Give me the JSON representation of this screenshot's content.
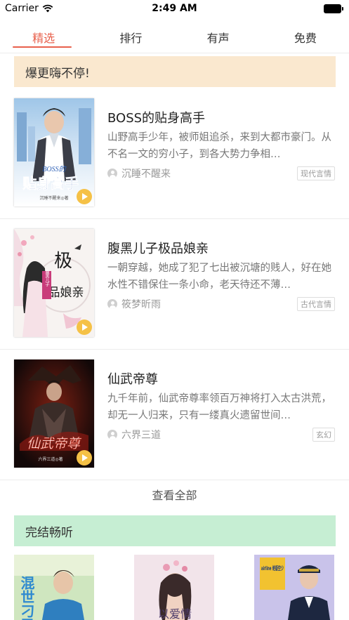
{
  "status_bar": {
    "carrier": "Carrier",
    "time": "2:49 AM"
  },
  "tabs": [
    {
      "label": "精选",
      "active": true
    },
    {
      "label": "排行",
      "active": false
    },
    {
      "label": "有声",
      "active": false
    },
    {
      "label": "免费",
      "active": false
    }
  ],
  "promo_banner": {
    "text": "爆更嗨不停!"
  },
  "books": [
    {
      "title": "BOSS的贴身高手",
      "description": "山野高手少年，被师姐追杀，来到大都市豪门。从不名一文的穷小子，到各大势力争相…",
      "author": "沉睡不醒来",
      "genre": "现代言情",
      "cover_text": {
        "line1": "BOSS的",
        "line2": "贴身高手",
        "byline": "沉睡不醒来◎著"
      }
    },
    {
      "title": "腹黑儿子极品娘亲",
      "description": "一朝穿越，她成了犯了七出被沉塘的贱人，好在她水性不错保住一条小命，老天待还不薄…",
      "author": "筱梦昕雨",
      "genre": "古代言情",
      "cover_text": {
        "line1": "极",
        "line2": "品娘亲",
        "side": "腹黑儿子"
      }
    },
    {
      "title": "仙武帝尊",
      "description": "九千年前，仙武帝尊率领百万神将打入太古洪荒，却无一人归来，只有一缕真火遗留世间…",
      "author": "六界三道",
      "genre": "玄幻",
      "cover_text": {
        "line1": "仙武帝尊",
        "byline": "六界三道◎著"
      }
    }
  ],
  "view_all": {
    "label": "查看全部"
  },
  "section_banner": {
    "text": "完结畅听"
  },
  "bottom_covers": [
    {
      "text": "混世刁民"
    },
    {
      "text": "以爱情"
    },
    {
      "text": "airline 绝版空少"
    }
  ],
  "colors": {
    "accent": "#e8604c",
    "promo_bg": "#fae8cf",
    "section_bg": "#c6eed3",
    "play_badge": "#f5c146"
  },
  "icons": [
    "wifi-icon",
    "battery-icon",
    "author-icon",
    "play-icon"
  ]
}
